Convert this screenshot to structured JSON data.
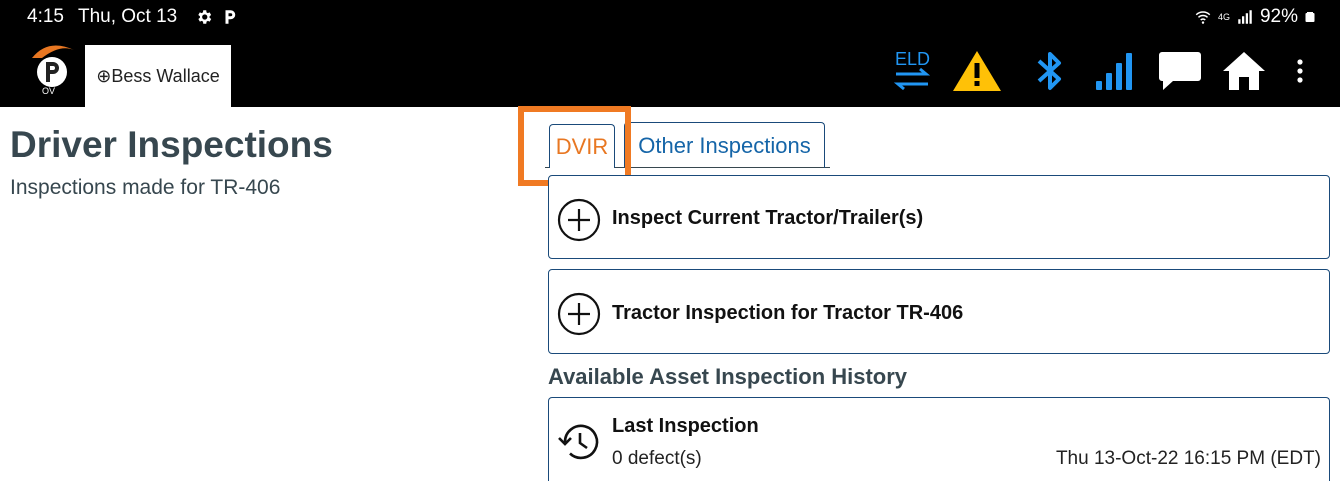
{
  "status_bar": {
    "time": "4:15",
    "date": "Thu, Oct 13",
    "battery": "92%",
    "network_label": "4G"
  },
  "app_bar": {
    "logo_text": "P",
    "logo_sub": "OV",
    "driver_tab_label": "⊕Bess Wallace",
    "eld_label": "ELD",
    "icons": [
      "eld-sync-icon",
      "warning-icon",
      "bluetooth-icon",
      "signal-icon",
      "message-icon",
      "home-icon",
      "more-vert-icon"
    ],
    "colors": {
      "accent_blue": "#2196f3",
      "warning_yellow": "#ffc107",
      "logo_orange": "#e87722"
    }
  },
  "page": {
    "title": "Driver Inspections",
    "subtitle": "Inspections made for TR-406"
  },
  "tabs": [
    {
      "label": "DVIR",
      "active": true
    },
    {
      "label": "Other Inspections",
      "active": false
    }
  ],
  "actions": [
    {
      "label": "Inspect Current Tractor/Trailer(s)",
      "icon": "add-circle-icon"
    },
    {
      "label": "Tractor Inspection for Tractor TR-406",
      "icon": "add-circle-icon"
    }
  ],
  "history": {
    "section_title": "Available Asset Inspection History",
    "items": [
      {
        "title": "Last Inspection",
        "defects": "0 defect(s)",
        "date": "Thu 13-Oct-22 16:15 PM (EDT)",
        "icon": "history-icon"
      }
    ]
  }
}
